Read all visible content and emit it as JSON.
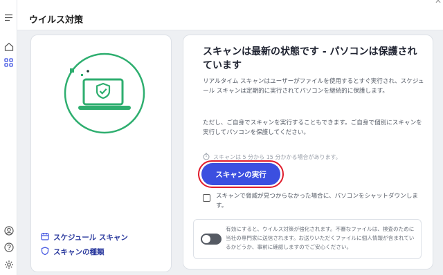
{
  "header": {
    "title": "ウイルス対策"
  },
  "sidebar": {
    "icons": [
      "menu-icon",
      "home-icon",
      "apps-icon",
      "account-icon",
      "help-icon",
      "settings-icon"
    ]
  },
  "left_card": {
    "links": [
      {
        "label": "スケジュール スキャン",
        "icon": "calendar-icon"
      },
      {
        "label": "スキャンの種類",
        "icon": "shield-icon"
      }
    ]
  },
  "right_card": {
    "heading": "スキャンは最新の状態です - パソコンは保護されています",
    "paragraph1": "リアルタイム スキャンはユーザーがファイルを使用するとすぐ実行され、スケジュール スキャンは定期的に実行されてパソコンを継続的に保護します。",
    "paragraph2": "ただし、ご自身でスキャンを実行することもできます。ご自身で個別にスキャンを実行してパソコンを保護してください。",
    "duration_note": "スキャンは 5 分から 15 分かかる場合があります。",
    "scan_button": "スキャンの実行",
    "shutdown_checkbox": "スキャンで脅威が見つからなかった場合に、パソコンをシャットダウンします。",
    "info_text": "有効にすると、ウイルス対策が強化されます。不審なファイルは、検査のために当社の専門家に送信されます。お送りいただくファイルに個人情報が含まれているかどうか、事前に確認しますのでご安心ください。"
  },
  "colors": {
    "accent": "#3b4fe0",
    "highlight_ring": "#e01b2b",
    "illustration": "#2eae6f"
  }
}
